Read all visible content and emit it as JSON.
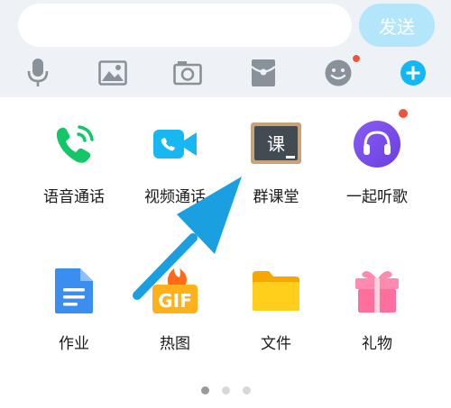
{
  "input_bar": {
    "message_value": "",
    "send_label": "发送"
  },
  "toolbar": {
    "icons": [
      "microphone-icon",
      "image-icon",
      "camera-icon",
      "red-packet-icon",
      "emoji-icon",
      "plus-icon"
    ]
  },
  "apps": [
    {
      "label": "语音通话",
      "icon": "voice-call-icon"
    },
    {
      "label": "视频通话",
      "icon": "video-call-icon"
    },
    {
      "label": "群课堂",
      "icon": "group-classroom-icon",
      "badge_text": "课"
    },
    {
      "label": "一起听歌",
      "icon": "listen-together-icon"
    },
    {
      "label": "作业",
      "icon": "homework-icon"
    },
    {
      "label": "热图",
      "icon": "hot-gif-icon",
      "badge_text": "GIF"
    },
    {
      "label": "文件",
      "icon": "folder-icon"
    },
    {
      "label": "礼物",
      "icon": "gift-icon"
    }
  ],
  "page_indicator": {
    "pages": 3,
    "current": 1
  },
  "colors": {
    "accent": "#12b7f5",
    "send_button": "#b4e6fb",
    "toolbar_bg": "#eef1f6",
    "badge_red": "#f2533c",
    "arrow": "#1aa0e0"
  }
}
